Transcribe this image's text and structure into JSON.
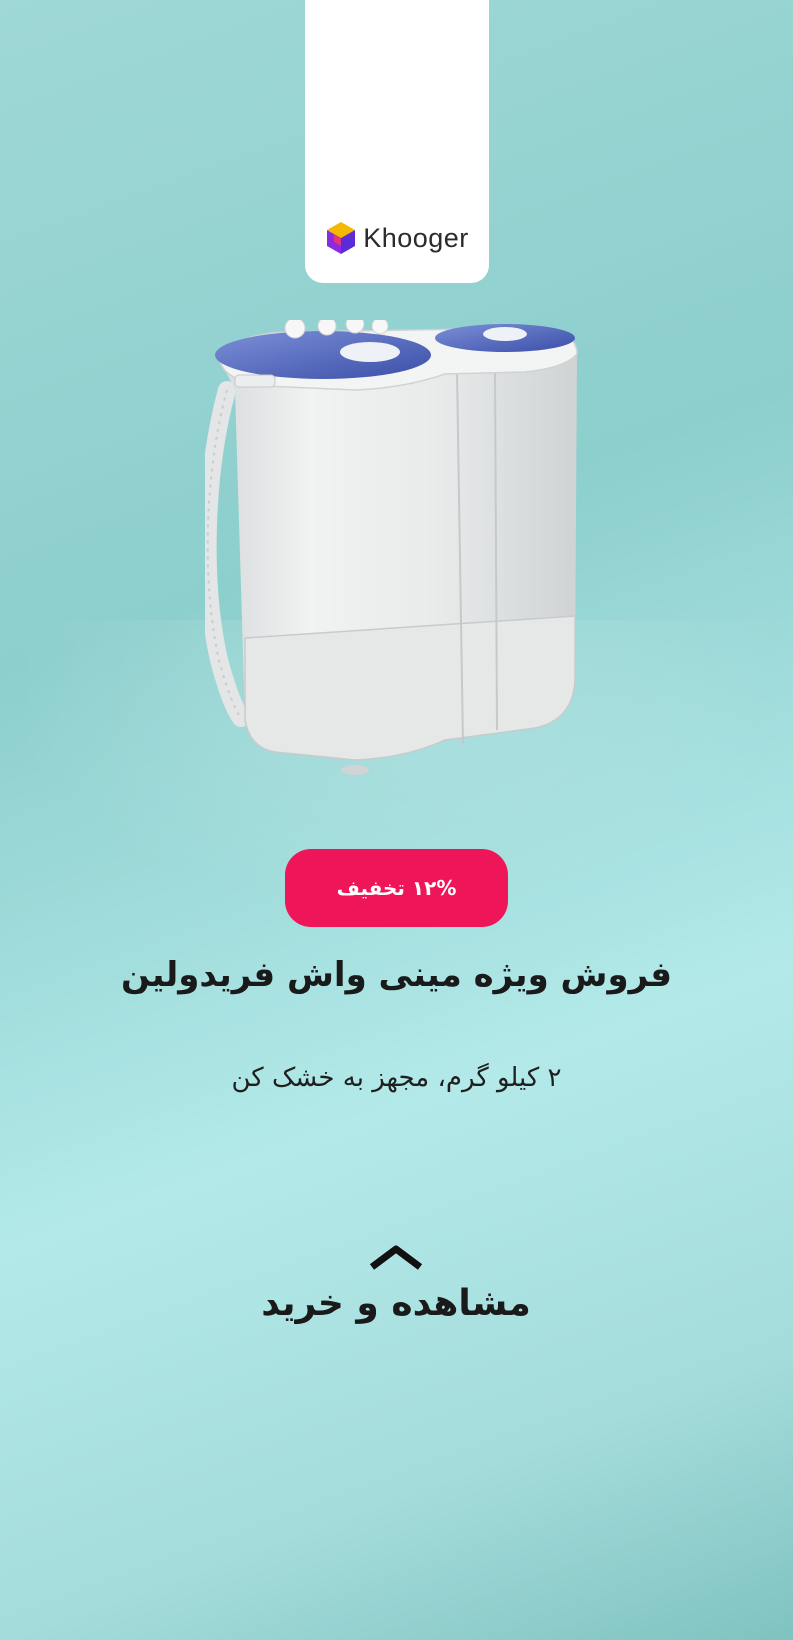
{
  "brand": {
    "name": "Khooger",
    "logo_icon": "khooger-cube-logo"
  },
  "product": {
    "image_icon": "twin-tub-mini-washing-machine"
  },
  "discount": {
    "label": "۱۲% تخفیف",
    "color": "#ee1558"
  },
  "headline": "فروش ویژه مینی واش فریدولین",
  "subline": "۲ کیلو گرم، مجهز به خشک کن",
  "cta": {
    "label": "مشاهده و خرید",
    "icon": "chevron-up-icon"
  },
  "colors": {
    "background": "#9fd8d6",
    "text": "#1a1a1a",
    "tab": "#ffffff"
  }
}
